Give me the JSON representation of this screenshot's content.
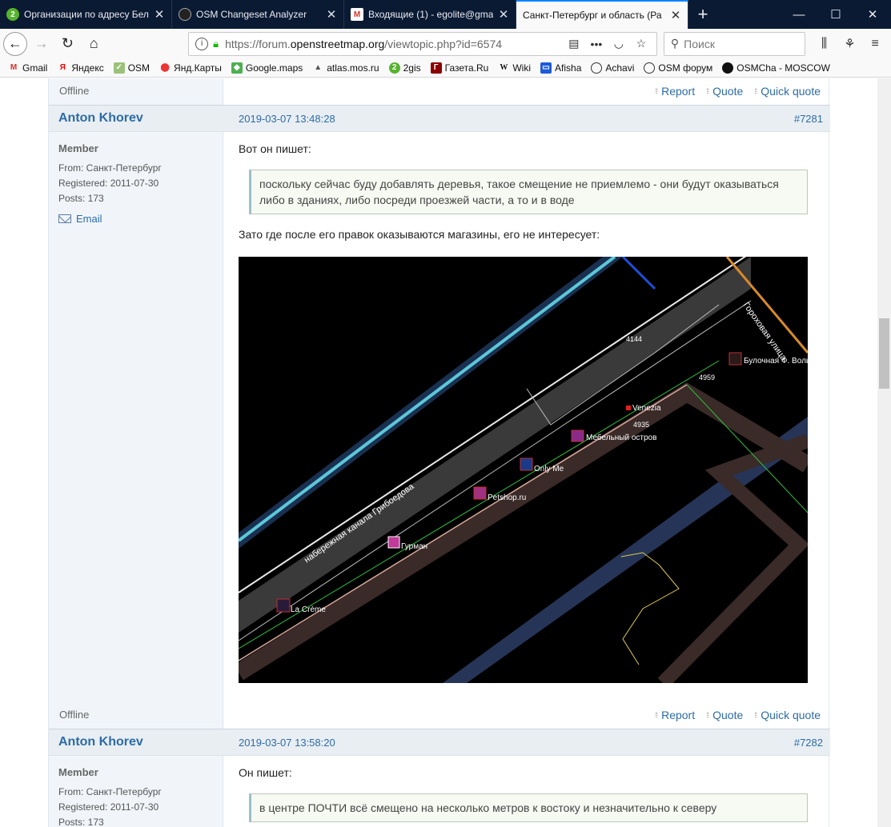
{
  "browser": {
    "tabs": [
      {
        "title": "Организации по адресу Бел",
        "favicon": "2gis-icon",
        "active": false
      },
      {
        "title": "OSM Changeset Analyzer",
        "favicon": "osm-icon",
        "active": false
      },
      {
        "title": "Входящие (1) - egolite@gma",
        "favicon": "gmail-icon",
        "active": false
      },
      {
        "title": "Санкт-Петербург и область (Ра",
        "favicon": "",
        "active": true
      }
    ],
    "url_prefix": "https://forum.",
    "url_domain": "openstreetmap.org",
    "url_rest": "/viewtopic.php?id=6574",
    "search_placeholder": "Поиск",
    "bookmarks": [
      "Gmail",
      "Яндекс",
      "OSM",
      "Янд.Карты",
      "Google.maps",
      "atlas.mos.ru",
      "2gis",
      "Газета.Ru",
      "Wiki",
      "Afisha",
      "Achavi",
      "OSM форум",
      "OSMCha - MOSCOW"
    ]
  },
  "top_footer": {
    "status": "Offline",
    "actions": [
      "Report",
      "Quote",
      "Quick quote"
    ]
  },
  "posts": [
    {
      "author": "Anton Khorev",
      "date": "2019-03-07 13:48:28",
      "number": "#7281",
      "role": "Member",
      "from": "From: Санкт-Петербург",
      "registered": "Registered: 2011-07-30",
      "posts": "Posts: 173",
      "email": "Email",
      "intro": "Вот он пишет:",
      "quote": "поскольку сейчас буду добавлять деревья, такое смещение не приемлемо - они будут оказываться либо в зданиях, либо посреди проезжей части, а то и в воде",
      "outro": "Зато где после его правок оказываются магазины, его не интересует:",
      "status": "Offline",
      "actions": [
        "Report",
        "Quote",
        "Quick quote"
      ]
    },
    {
      "author": "Anton Khorev",
      "date": "2019-03-07 13:58:20",
      "number": "#7282",
      "role": "Member",
      "from": "From: Санкт-Петербург",
      "registered": "Registered: 2011-07-30",
      "posts": "Posts: 173",
      "intro": "Он пишет:",
      "quote": "в центре ПОЧТИ всё смещено на несколько метров к востоку и незначительно к северу"
    }
  ],
  "map": {
    "street_labels": [
      "набережная канала Грибоедова",
      "Гороховая улица"
    ],
    "pois": [
      {
        "name": "La Crème",
        "icon": "eye-icon"
      },
      {
        "name": "Гурман",
        "icon": "deli-icon"
      },
      {
        "name": "Petshop.ru",
        "icon": "paw-icon"
      },
      {
        "name": "Only Me",
        "icon": "shirt-icon"
      },
      {
        "name": "Мебельный остров",
        "icon": "furniture-icon"
      },
      {
        "name": "Venezia",
        "icon": "dot-icon"
      },
      {
        "name": "Булочная Ф. Вольфа",
        "icon": "bakery-icon"
      }
    ],
    "house_numbers": [
      "4144",
      "4959",
      "4935"
    ]
  }
}
